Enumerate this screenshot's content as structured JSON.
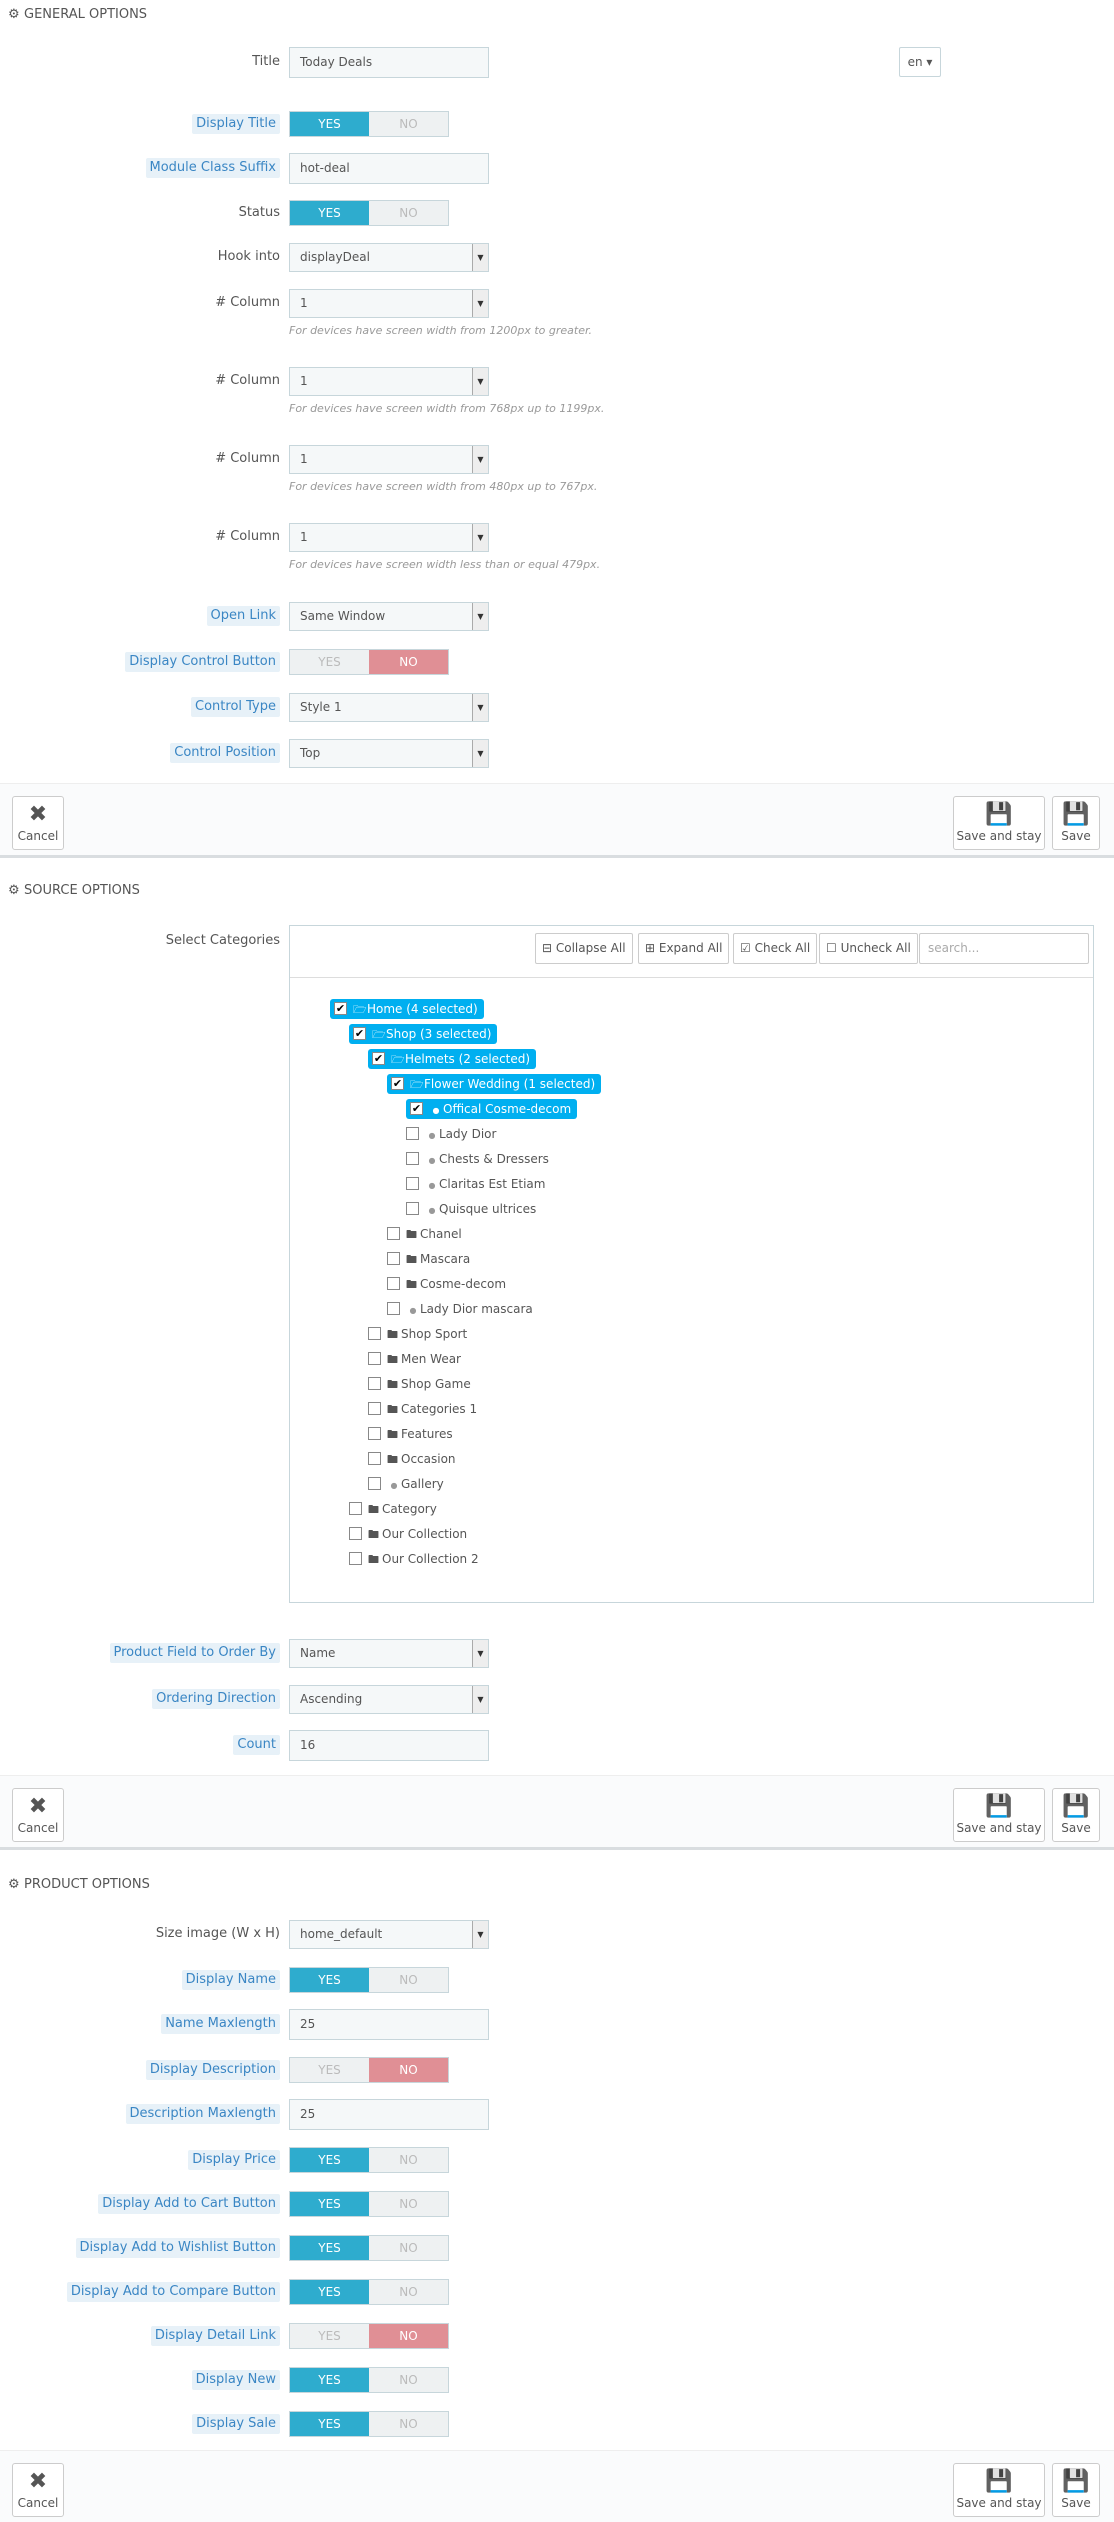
{
  "general": {
    "heading": "GENERAL OPTIONS",
    "title_label": "Title",
    "title_value": "Today Deals",
    "lang": "en",
    "display_title_label": "Display Title",
    "module_class_label": "Module Class Suffix",
    "module_class_value": "hot-deal",
    "status_label": "Status",
    "hook_label": "Hook into",
    "hook_value": "displayDeal",
    "col_label": "# Column",
    "col1_value": "1",
    "col1_hint": "For devices have screen width from 1200px to greater.",
    "col2_value": "1",
    "col2_hint": "For devices have screen width from 768px up to 1199px.",
    "col3_value": "1",
    "col3_hint": "For devices have screen width from 480px up to 767px.",
    "col4_value": "1",
    "col4_hint": "For devices have screen width less than or equal 479px.",
    "open_link_label": "Open Link",
    "open_link_value": "Same Window",
    "display_control_label": "Display Control Button",
    "control_type_label": "Control Type",
    "control_type_value": "Style 1",
    "control_position_label": "Control Position",
    "control_position_value": "Top"
  },
  "switch": {
    "yes": "YES",
    "no": "NO"
  },
  "footer": {
    "cancel": "Cancel",
    "save_stay": "Save and stay",
    "save": "Save"
  },
  "source": {
    "heading": "SOURCE OPTIONS",
    "select_categories_label": "Select Categories",
    "collapse_all": "Collapse All",
    "expand_all": "Expand All",
    "check_all": "Check All",
    "uncheck_all": "Uncheck All",
    "search_placeholder": "search...",
    "tree": [
      {
        "label": "Home (4 selected)",
        "depth": 0,
        "checked": true,
        "selected": true,
        "kind": "folder-open"
      },
      {
        "label": "Shop (3 selected)",
        "depth": 1,
        "checked": true,
        "selected": true,
        "kind": "folder-open"
      },
      {
        "label": "Helmets (2 selected)",
        "depth": 2,
        "checked": true,
        "selected": true,
        "kind": "folder-open"
      },
      {
        "label": "Flower Wedding (1 selected)",
        "depth": 3,
        "checked": true,
        "selected": true,
        "kind": "folder-open"
      },
      {
        "label": "Offical Cosme-decom",
        "depth": 4,
        "checked": true,
        "selected": true,
        "kind": "leaf"
      },
      {
        "label": "Lady Dior",
        "depth": 4,
        "checked": false,
        "selected": false,
        "kind": "leaf"
      },
      {
        "label": "Chests & Dressers",
        "depth": 4,
        "checked": false,
        "selected": false,
        "kind": "leaf"
      },
      {
        "label": "Claritas Est Etiam",
        "depth": 4,
        "checked": false,
        "selected": false,
        "kind": "leaf"
      },
      {
        "label": "Quisque ultrices",
        "depth": 4,
        "checked": false,
        "selected": false,
        "kind": "leaf"
      },
      {
        "label": "Chanel",
        "depth": 3,
        "checked": false,
        "selected": false,
        "kind": "folder"
      },
      {
        "label": "Mascara",
        "depth": 3,
        "checked": false,
        "selected": false,
        "kind": "folder"
      },
      {
        "label": "Cosme-decom",
        "depth": 3,
        "checked": false,
        "selected": false,
        "kind": "folder"
      },
      {
        "label": "Lady Dior mascara",
        "depth": 3,
        "checked": false,
        "selected": false,
        "kind": "leaf"
      },
      {
        "label": "Shop Sport",
        "depth": 2,
        "checked": false,
        "selected": false,
        "kind": "folder"
      },
      {
        "label": "Men Wear",
        "depth": 2,
        "checked": false,
        "selected": false,
        "kind": "folder"
      },
      {
        "label": "Shop Game",
        "depth": 2,
        "checked": false,
        "selected": false,
        "kind": "folder"
      },
      {
        "label": "Categories 1",
        "depth": 2,
        "checked": false,
        "selected": false,
        "kind": "folder"
      },
      {
        "label": "Features",
        "depth": 2,
        "checked": false,
        "selected": false,
        "kind": "folder"
      },
      {
        "label": "Occasion",
        "depth": 2,
        "checked": false,
        "selected": false,
        "kind": "folder"
      },
      {
        "label": "Gallery",
        "depth": 2,
        "checked": false,
        "selected": false,
        "kind": "leaf"
      },
      {
        "label": "Category",
        "depth": 1,
        "checked": false,
        "selected": false,
        "kind": "folder"
      },
      {
        "label": "Our Collection",
        "depth": 1,
        "checked": false,
        "selected": false,
        "kind": "folder"
      },
      {
        "label": "Our Collection 2",
        "depth": 1,
        "checked": false,
        "selected": false,
        "kind": "folder"
      }
    ],
    "order_by_label": "Product Field to Order By",
    "order_by_value": "Name",
    "direction_label": "Ordering Direction",
    "direction_value": "Ascending",
    "count_label": "Count",
    "count_value": "16"
  },
  "product": {
    "heading": "PRODUCT OPTIONS",
    "size_label": "Size image (W x H)",
    "size_value": "home_default",
    "display_name_label": "Display Name",
    "name_maxlength_label": "Name Maxlength",
    "name_maxlength_value": "25",
    "display_desc_label": "Display Description",
    "desc_maxlength_label": "Description Maxlength",
    "desc_maxlength_value": "25",
    "display_price_label": "Display Price",
    "display_cart_label": "Display Add to Cart Button",
    "display_wishlist_label": "Display Add to Wishlist Button",
    "display_compare_label": "Display Add to Compare Button",
    "display_detail_label": "Display Detail Link",
    "display_new_label": "Display New",
    "display_sale_label": "Display Sale"
  }
}
